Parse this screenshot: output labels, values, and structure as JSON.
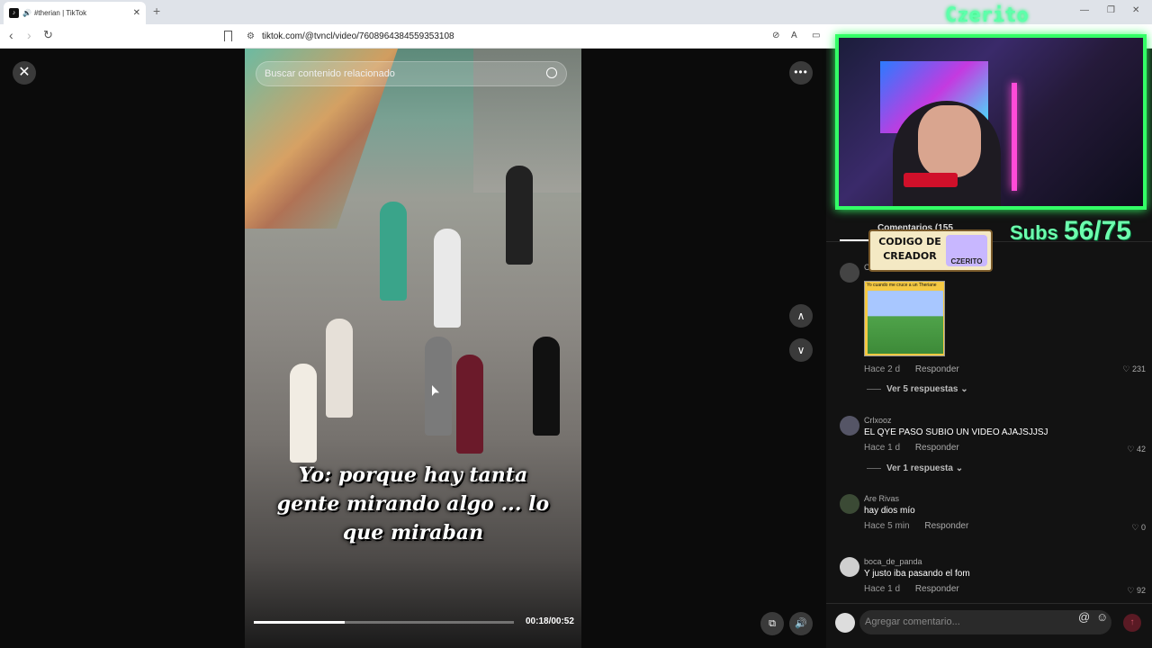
{
  "browser": {
    "tab_title": "#therian | TikTok",
    "new_tab": "+",
    "url": "tiktok.com/@tvncl/video/7608964384559353108"
  },
  "video": {
    "search_placeholder": "Buscar contenido relacionado",
    "caption": "Yo: porque hay tanta gente mirando algo ... lo que miraban",
    "time": "00:18/00:52",
    "progress": 0.35
  },
  "overlay": {
    "streamer_name": "Czerito",
    "subs_label": "Subs",
    "subs_count": "56/75",
    "creator_code": "CODIGO DE CREADOR",
    "creator_logo": "CZERITO"
  },
  "comments_panel": {
    "tab_label": "Comentarios (155",
    "comments": [
      {
        "user": "C",
        "image_caption": "Yo cuando me cruce a un Theriane",
        "time": "Hace 2 d",
        "reply": "Responder",
        "likes": "231",
        "thread": "Ver 5 respuestas"
      },
      {
        "user": "Crlxooz",
        "text": "EL QYE PASO SUBIO UN VIDEO AJAJSJJSJ",
        "time": "Hace 1 d",
        "reply": "Responder",
        "likes": "42",
        "thread": "Ver 1 respuesta"
      },
      {
        "user": "Are Rivas",
        "text": "hay dios mío",
        "time": "Hace 5 min",
        "reply": "Responder",
        "likes": "0"
      },
      {
        "user": "boca_de_panda",
        "text": "Y justo iba pasando el fom",
        "time": "Hace 1 d",
        "reply": "Responder",
        "likes": "92"
      }
    ],
    "composer_placeholder": "Agregar comentario..."
  }
}
